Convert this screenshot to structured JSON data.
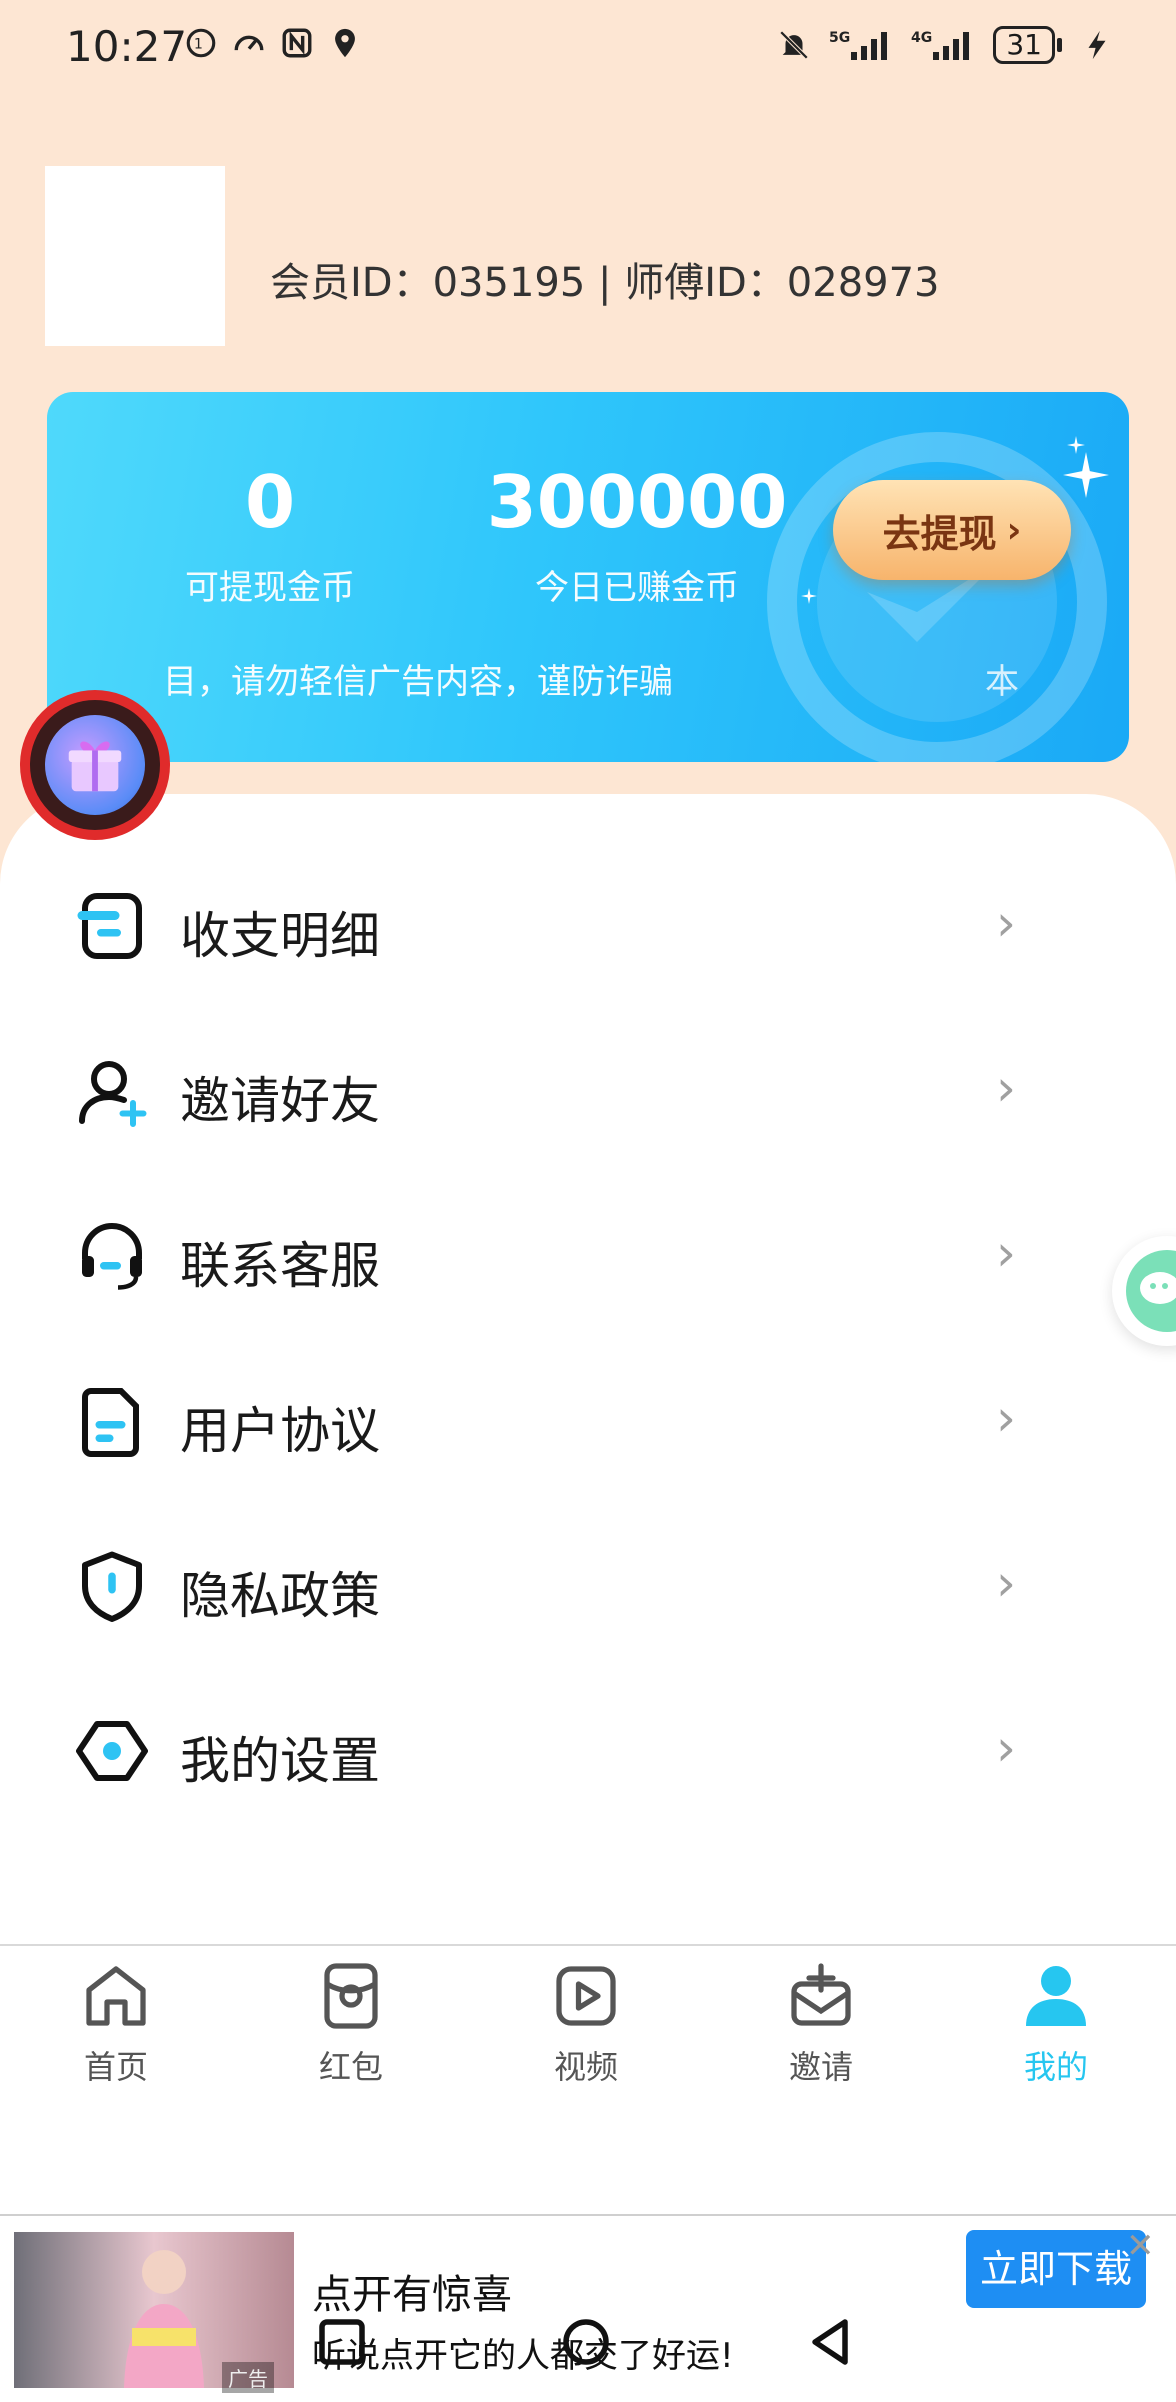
{
  "status_bar": {
    "time": "10:27",
    "battery": "31"
  },
  "profile": {
    "ids_text": "会员ID：035195 | 师傅ID：028973"
  },
  "wallet": {
    "withdrawable_value": "0",
    "withdrawable_label": "可提现金币",
    "today_value": "300000",
    "today_label": "今日已赚金币",
    "withdraw_button": "去提现",
    "marquee_text": "目，请勿轻信广告内容，谨防诈骗",
    "marquee_tail": "本"
  },
  "menu": {
    "items": [
      {
        "label": "收支明细",
        "icon": "ledger-icon"
      },
      {
        "label": "邀请好友",
        "icon": "add-user-icon"
      },
      {
        "label": "联系客服",
        "icon": "headset-icon"
      },
      {
        "label": "用户协议",
        "icon": "document-icon"
      },
      {
        "label": "隐私政策",
        "icon": "shield-icon"
      },
      {
        "label": "我的设置",
        "icon": "settings-icon"
      }
    ]
  },
  "tabs": [
    {
      "label": "首页",
      "icon": "home-icon",
      "active": false
    },
    {
      "label": "红包",
      "icon": "red-packet-icon",
      "active": false
    },
    {
      "label": "视频",
      "icon": "video-icon",
      "active": false
    },
    {
      "label": "邀请",
      "icon": "invite-icon",
      "active": false
    },
    {
      "label": "我的",
      "icon": "profile-icon",
      "active": true
    }
  ],
  "ad": {
    "title": "点开有惊喜",
    "subtitle": "听说点开它的人都交了好运!",
    "button": "立即下载",
    "tag": "广告"
  },
  "colors": {
    "accent": "#26c6f0",
    "page_bg": "#fde6d3",
    "ad_button": "#1e8ef3"
  }
}
